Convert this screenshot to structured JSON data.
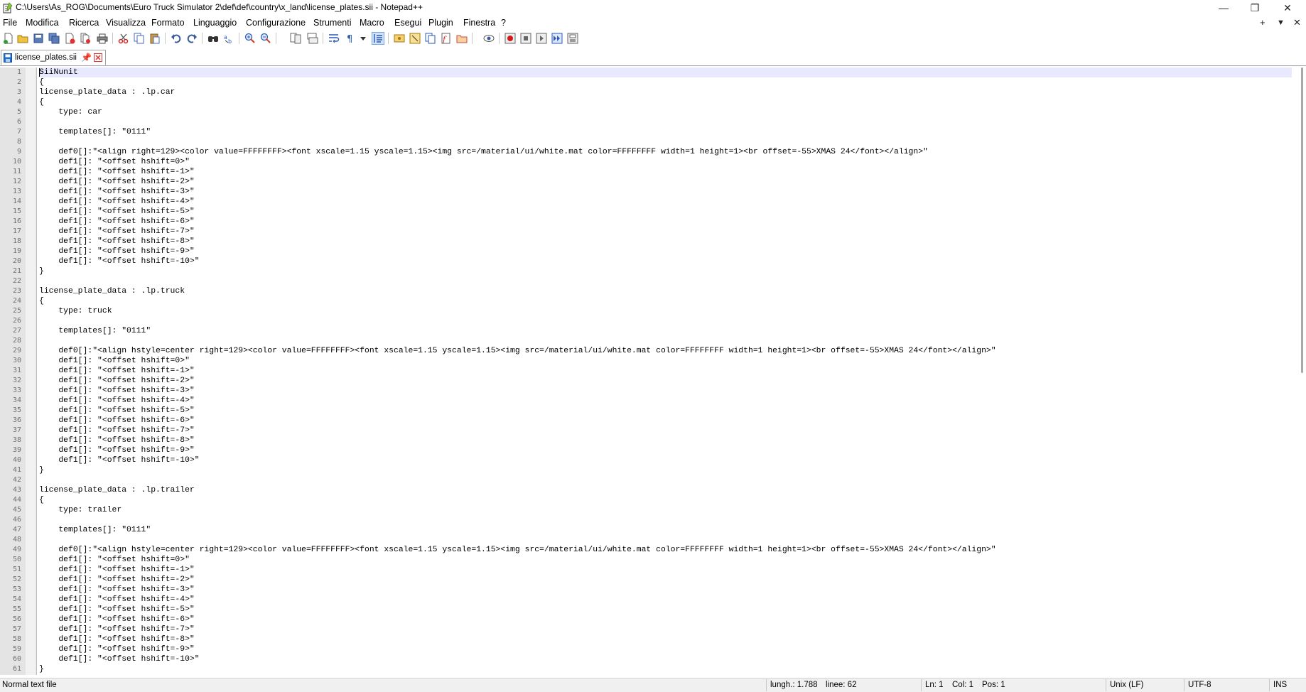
{
  "window": {
    "title": "C:\\Users\\As_ROG\\Documents\\Euro Truck Simulator 2\\def\\def\\country\\x_land\\license_plates.sii - Notepad++",
    "controls": {
      "minimize": "—",
      "maximize": "❐",
      "close": "✕"
    }
  },
  "menu": {
    "items": [
      "File",
      "Modifica",
      "Ricerca",
      "Visualizza",
      "Formato",
      "Linguaggio",
      "Configurazione",
      "Strumenti",
      "Macro",
      "Esegui",
      "Plugin",
      "Finestra",
      "?"
    ],
    "right_controls": [
      "+",
      "▼",
      "✕"
    ]
  },
  "toolbar": {
    "icons": [
      "new-file-icon",
      "open-file-icon",
      "save-icon",
      "save-all-icon",
      "close-icon",
      "close-all-icon",
      "print-icon",
      "cut-icon",
      "copy-icon",
      "paste-icon",
      "undo-icon",
      "redo-icon",
      "find-icon",
      "replace-icon",
      "zoom-in-icon",
      "zoom-out-icon",
      "sync-vertical-icon",
      "sync-horizontal-icon",
      "word-wrap-icon",
      "show-all-chars-icon",
      "dropdown-icon",
      "indent-guide-icon",
      "user-language-icon",
      "doc-map-icon",
      "doc-list-icon",
      "function-list-icon",
      "folder-workspace-icon",
      "monitoring-icon",
      "record-macro-icon",
      "stop-macro-icon",
      "play-macro-icon",
      "run-macro-multiple-icon",
      "save-macro-icon"
    ]
  },
  "tab": {
    "label": "license_plates.sii"
  },
  "editor": {
    "lines": [
      "SiiNunit",
      "{",
      "license_plate_data : .lp.car",
      "{",
      "    type: car",
      "",
      "    templates[]: \"0111\"",
      "",
      "    def0[]:\"<align right=129><color value=FFFFFFFF><font xscale=1.15 yscale=1.15><img src=/material/ui/white.mat color=FFFFFFFF width=1 height=1><br offset=-55>XMAS 24</font></align>\"",
      "    def1[]: \"<offset hshift=0>\"",
      "    def1[]: \"<offset hshift=-1>\"",
      "    def1[]: \"<offset hshift=-2>\"",
      "    def1[]: \"<offset hshift=-3>\"",
      "    def1[]: \"<offset hshift=-4>\"",
      "    def1[]: \"<offset hshift=-5>\"",
      "    def1[]: \"<offset hshift=-6>\"",
      "    def1[]: \"<offset hshift=-7>\"",
      "    def1[]: \"<offset hshift=-8>\"",
      "    def1[]: \"<offset hshift=-9>\"",
      "    def1[]: \"<offset hshift=-10>\"",
      "}",
      "",
      "license_plate_data : .lp.truck",
      "{",
      "    type: truck",
      "",
      "    templates[]: \"0111\"",
      "",
      "    def0[]:\"<align hstyle=center right=129><color value=FFFFFFFF><font xscale=1.15 yscale=1.15><img src=/material/ui/white.mat color=FFFFFFFF width=1 height=1><br offset=-55>XMAS 24</font></align>\"",
      "    def1[]: \"<offset hshift=0>\"",
      "    def1[]: \"<offset hshift=-1>\"",
      "    def1[]: \"<offset hshift=-2>\"",
      "    def1[]: \"<offset hshift=-3>\"",
      "    def1[]: \"<offset hshift=-4>\"",
      "    def1[]: \"<offset hshift=-5>\"",
      "    def1[]: \"<offset hshift=-6>\"",
      "    def1[]: \"<offset hshift=-7>\"",
      "    def1[]: \"<offset hshift=-8>\"",
      "    def1[]: \"<offset hshift=-9>\"",
      "    def1[]: \"<offset hshift=-10>\"",
      "}",
      "",
      "license_plate_data : .lp.trailer",
      "{",
      "    type: trailer",
      "",
      "    templates[]: \"0111\"",
      "",
      "    def0[]:\"<align hstyle=center right=129><color value=FFFFFFFF><font xscale=1.15 yscale=1.15><img src=/material/ui/white.mat color=FFFFFFFF width=1 height=1><br offset=-55>XMAS 24</font></align>\"",
      "    def1[]: \"<offset hshift=0>\"",
      "    def1[]: \"<offset hshift=-1>\"",
      "    def1[]: \"<offset hshift=-2>\"",
      "    def1[]: \"<offset hshift=-3>\"",
      "    def1[]: \"<offset hshift=-4>\"",
      "    def1[]: \"<offset hshift=-5>\"",
      "    def1[]: \"<offset hshift=-6>\"",
      "    def1[]: \"<offset hshift=-7>\"",
      "    def1[]: \"<offset hshift=-8>\"",
      "    def1[]: \"<offset hshift=-9>\"",
      "    def1[]: \"<offset hshift=-10>\"",
      "}"
    ],
    "current_line": 1
  },
  "status": {
    "file_type": "Normal text file",
    "length": "lungh.: 1.788",
    "lines": "linee: 62",
    "ln": "Ln: 1",
    "col": "Col: 1",
    "pos": "Pos: 1",
    "eol": "Unix (LF)",
    "encoding": "UTF-8",
    "mode": "INS"
  },
  "colors": {
    "current_line_bg": "#e8e8ff",
    "gutter_bg": "#e4e4e4",
    "line_number": "#707070",
    "tab_save_icon": "#1e6fd0",
    "tab_close": "#e03030"
  }
}
